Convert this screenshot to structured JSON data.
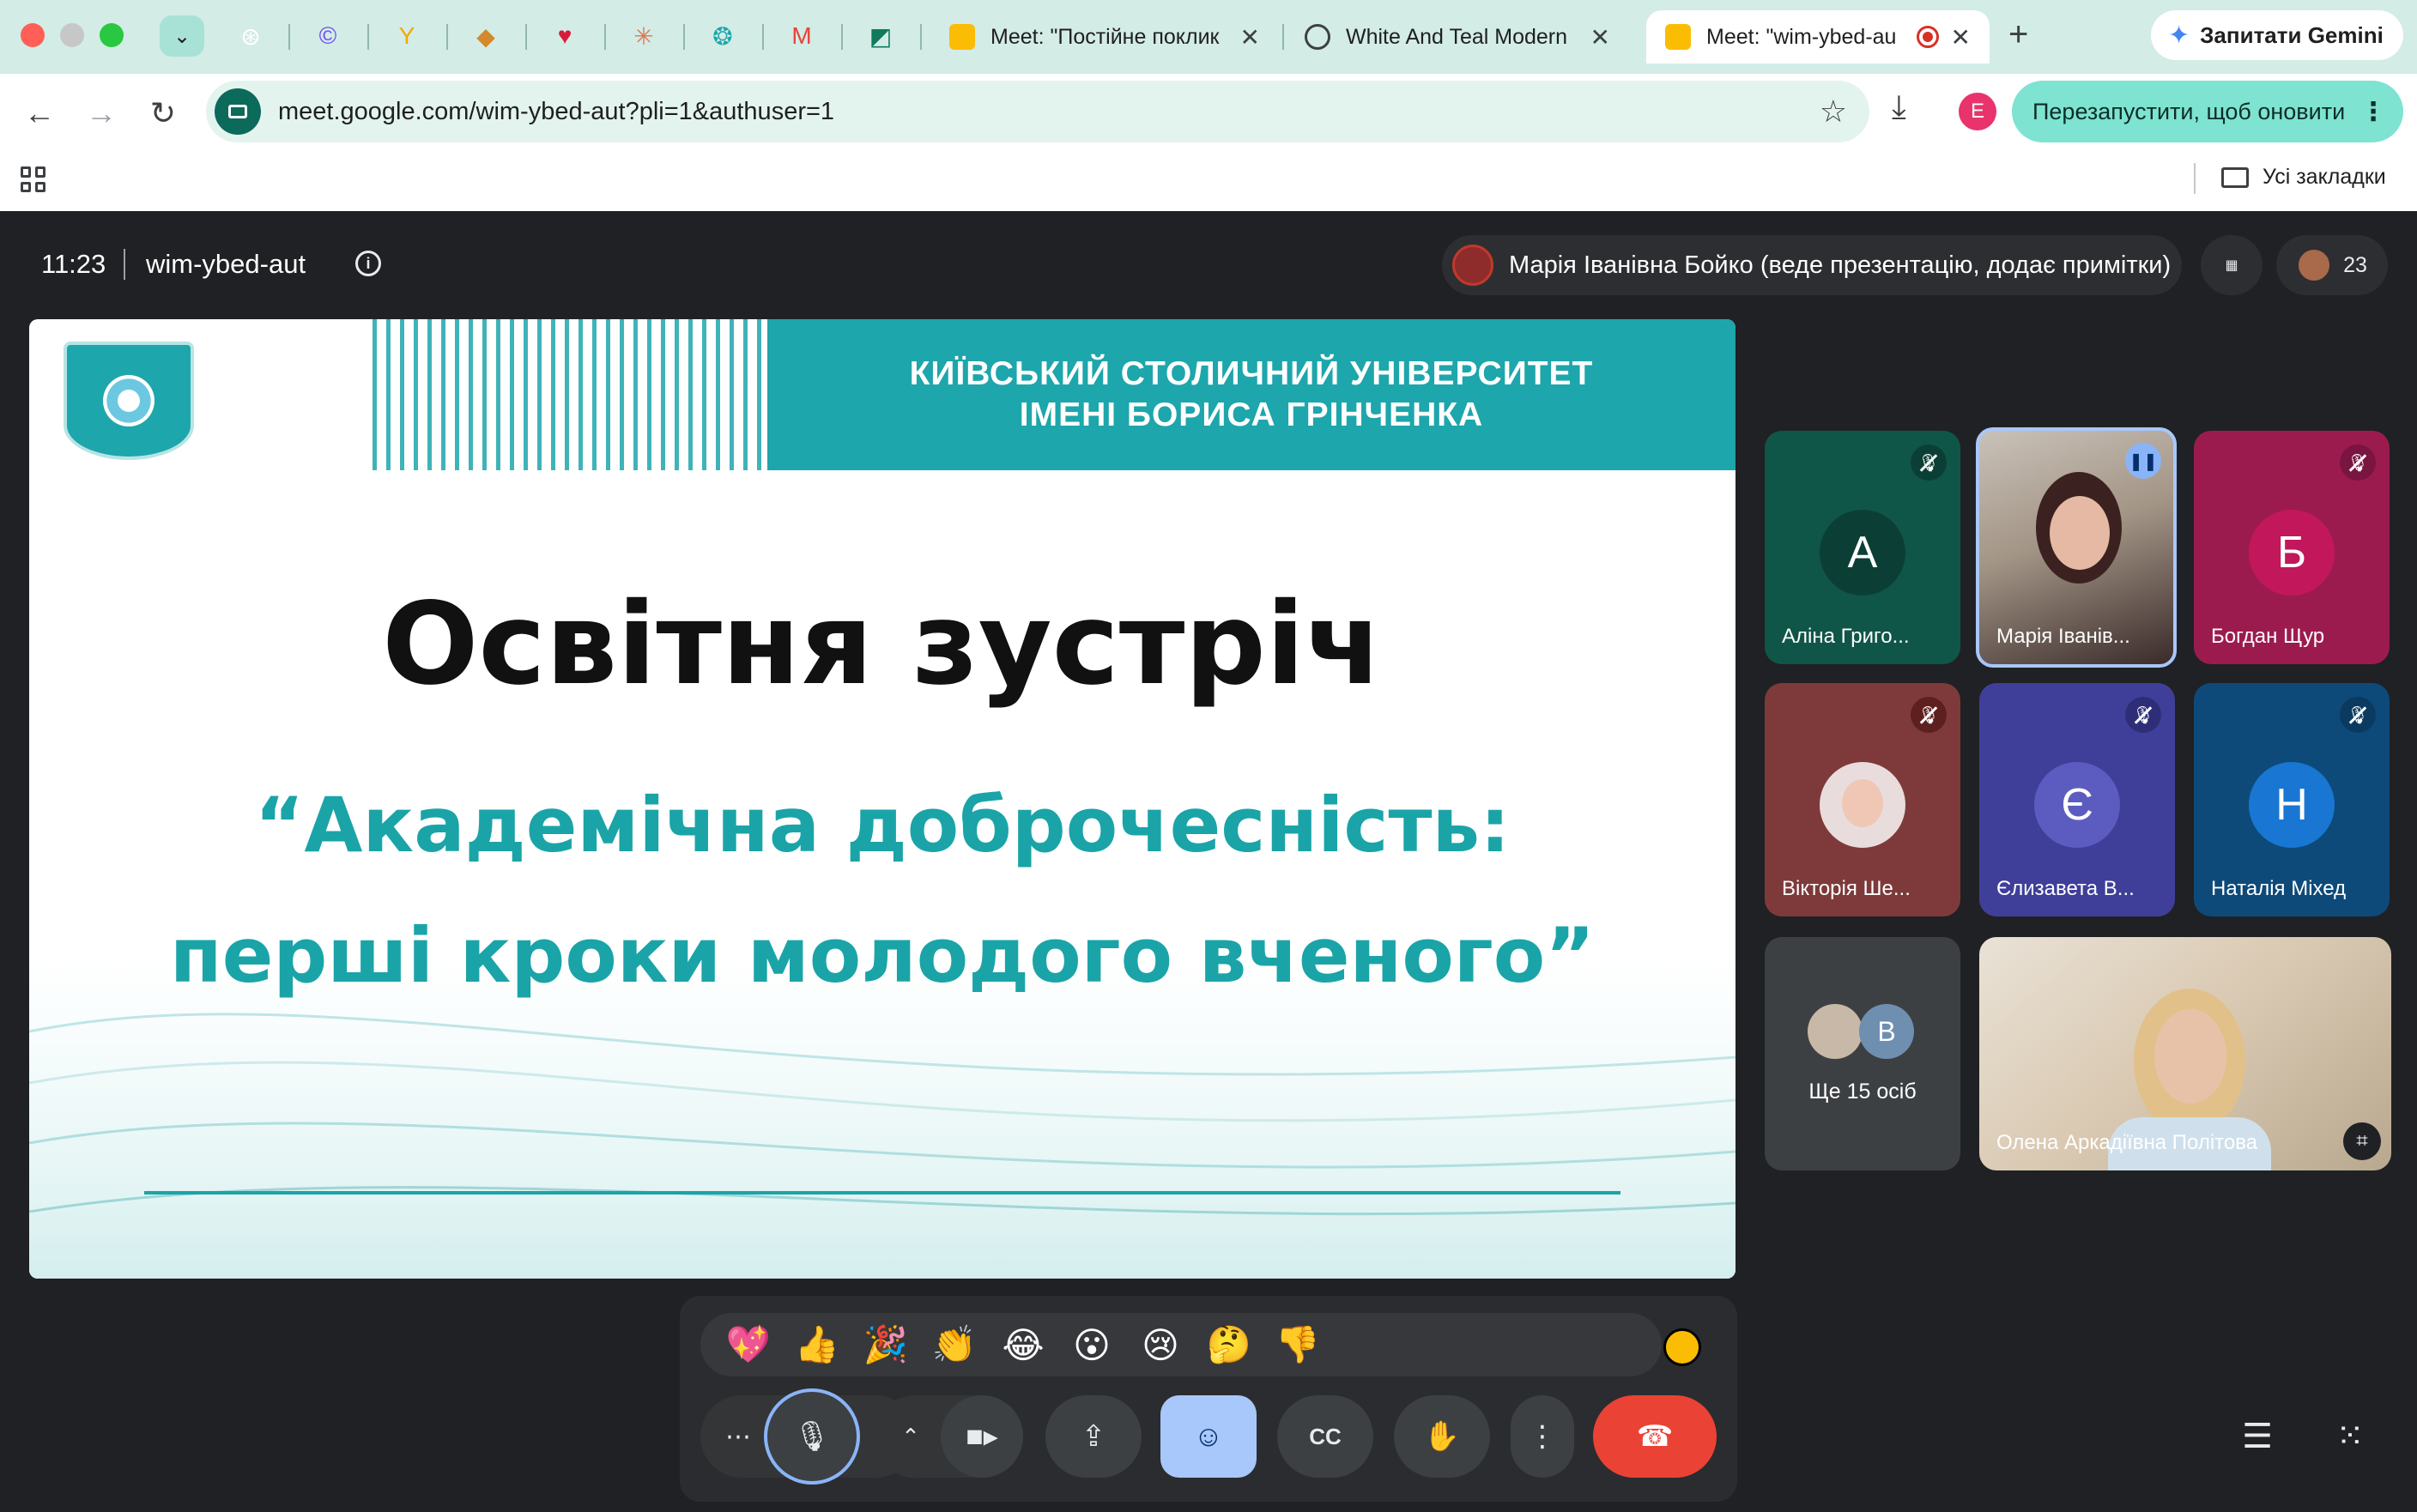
{
  "browser": {
    "tabs": [
      {
        "title": "Meet: \"Постійне поклик",
        "icon": "meet-icon"
      },
      {
        "title": "White And Teal Modern",
        "icon": "globe-icon"
      },
      {
        "title": "Meet: \"wim-ybed-au",
        "icon": "meet-icon",
        "active": true
      }
    ],
    "gemini_label": "Запитати Gemini",
    "url": "meet.google.com/wim-ybed-aut?pli=1&authuser=1",
    "profile_letter": "E",
    "update_label": "Перезапустити, щоб оновити",
    "all_bookmarks": "Усі закладки"
  },
  "meet": {
    "time": "11:23",
    "code": "wim-ybed-aut",
    "presenter_label": "Марія Іванівна Бойко (веде презентацію, додає примітки)",
    "participant_count": "23",
    "colors": {
      "bg": "#202124",
      "accent": "#a8c7fa",
      "end": "#ea4335",
      "teal": "#1aa4a8"
    }
  },
  "slide": {
    "university_line1": "КИЇВСЬКИЙ СТОЛИЧНИЙ УНІВЕРСИТЕТ",
    "university_line2": "ІМЕНІ БОРИСА ГРІНЧЕНКА",
    "title": "Освітня зустріч",
    "subtitle_line1": "“Академічна доброчесність:",
    "subtitle_line2": "перші кроки молодого вченого”"
  },
  "participants": [
    {
      "name": "Аліна Григо...",
      "initial": "А",
      "bg": "#0f5649",
      "avatar_bg": "#0b3f35",
      "muted": true
    },
    {
      "name": "Марія Іванів...",
      "speaking": true
    },
    {
      "name": "Богдан Щур",
      "initial": "Б",
      "bg": "#9c1b4f",
      "avatar_bg": "#c2185b",
      "muted": true
    },
    {
      "name": "Вікторія Ше...",
      "bg": "#7e3a3a",
      "muted": true
    },
    {
      "name": "Єлизавета В...",
      "initial": "Є",
      "bg": "#3f3f9a",
      "avatar_bg": "#5c5cc0",
      "muted": true
    },
    {
      "name": "Наталія Міхед",
      "initial": "Н",
      "bg": "#0d4a7a",
      "avatar_bg": "#1976d2",
      "muted": true
    }
  ],
  "more_people": {
    "label": "Ще 15 осіб",
    "initial": "В"
  },
  "pinned_participant": {
    "name": "Олена Аркадіївна Політова"
  },
  "reactions": [
    "💖",
    "👍",
    "🎉",
    "👏",
    "😂",
    "😮",
    "😢",
    "🤔",
    "👎"
  ]
}
